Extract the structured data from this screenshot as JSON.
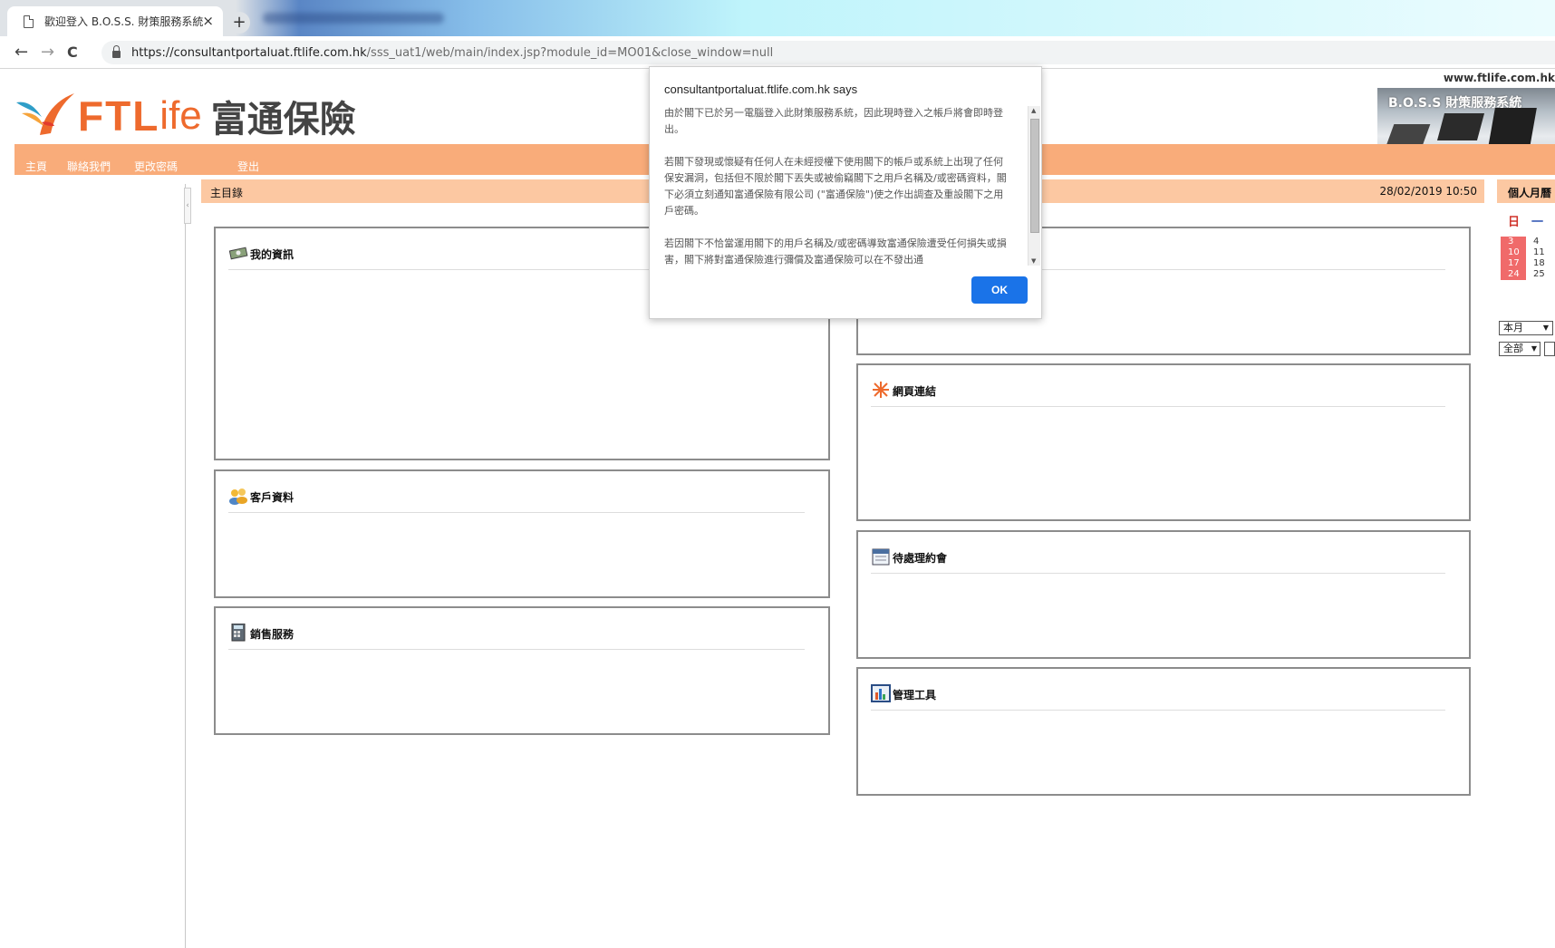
{
  "browser": {
    "tab_title": "歡迎登入 B.O.S.S. 財策服務系統",
    "tab_close": "×",
    "new_tab": "+",
    "url_host": "https://consultantportaluat.ftlife.com.hk",
    "url_path": "/sss_uat1/web/main/index.jsp?module_id=MO01&close_window=null",
    "nav": {
      "back": "←",
      "forward": "→",
      "reload": "C"
    }
  },
  "header": {
    "logo_ftl": "FTL",
    "logo_ife": "ife",
    "logo_chinese": "富通保險",
    "site_url": "www.ftlife.com.hk",
    "banner_title": "B.O.S.S 財策服務系統"
  },
  "menu": {
    "items": [
      "主頁",
      "聯絡我們",
      "更改密碼",
      "登出"
    ]
  },
  "subbar": {
    "title": "主目錄",
    "datetime": "28/02/2019 10:50"
  },
  "calendar": {
    "title": "個人月曆",
    "dow": [
      "日",
      "一"
    ],
    "sundays": [
      "3",
      "10",
      "17",
      "24"
    ],
    "mondays": [
      "4",
      "11",
      "18",
      "25"
    ],
    "select_month": "本月",
    "select_all": "全部",
    "select_arrow": "▼"
  },
  "panels": {
    "my_info": "我的資訊",
    "client_info": "客戶資料",
    "sales_service": "銷售服務",
    "web_links": "網頁連結",
    "pending_appointments": "待處理約會",
    "admin_tools": "管理工具"
  },
  "dialog": {
    "title": "consultantportaluat.ftlife.com.hk says",
    "paragraphs": [
      "由於閣下已於另一電腦登入此財策服務系統，因此現時登入之帳戶將會即時登出。",
      "若閣下發現或懷疑有任何人在未經授權下使用閣下的帳戶或系統上出現了任何保安漏洞，包括但不限於閣下丟失或被偷竊閣下之用戶名稱及/或密碼資料，閣下必須立刻通知富通保險有限公司 (\"富通保險\")使之作出調查及重設閣下之用戶密碼。",
      "若因閣下不恰當運用閣下的用戶名稱及/或密碼導致富通保險遭受任何損失或損害，閣下將對富通保險進行彌償及富通保險可以在不發出通"
    ],
    "ok_label": "OK"
  },
  "colors": {
    "orange_menu": "#f9ac7a",
    "subbar": "#fcc8a2",
    "ok_button": "#1a73e8",
    "logo_orange": "#ee6a2d"
  }
}
